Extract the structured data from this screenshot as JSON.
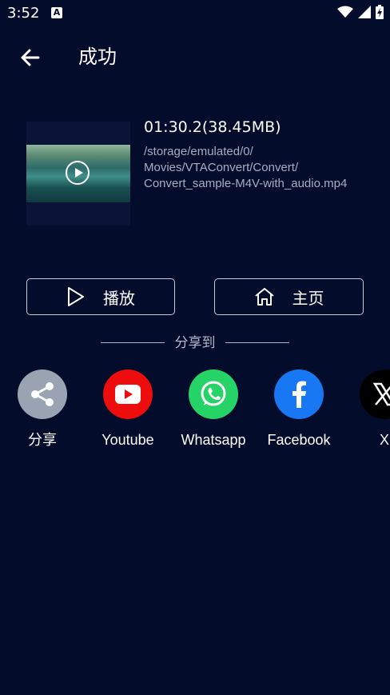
{
  "status": {
    "time": "3:52",
    "notification_icon": "A"
  },
  "header": {
    "title": "成功"
  },
  "file": {
    "duration_size": "01:30.2(38.45MB)",
    "path": "/storage/emulated/0/\nMovies/VTAConvert/Convert/\nConvert_sample-M4V-with_audio.mp4"
  },
  "actions": {
    "play_label": "播放",
    "home_label": "主页"
  },
  "share": {
    "title": "分享到",
    "items": [
      {
        "label": "分享",
        "icon": "share-icon",
        "color": "#9aa3b2"
      },
      {
        "label": "Youtube",
        "icon": "youtube-icon",
        "color": "#ee0d0d"
      },
      {
        "label": "Whatsapp",
        "icon": "whatsapp-icon",
        "color": "#25d366"
      },
      {
        "label": "Facebook",
        "icon": "facebook-icon",
        "color": "#1877f2"
      },
      {
        "label": "X",
        "icon": "x-icon",
        "color": "#000000"
      }
    ]
  },
  "colors": {
    "background": "#040c2c",
    "text_secondary": "#a8adc0"
  }
}
